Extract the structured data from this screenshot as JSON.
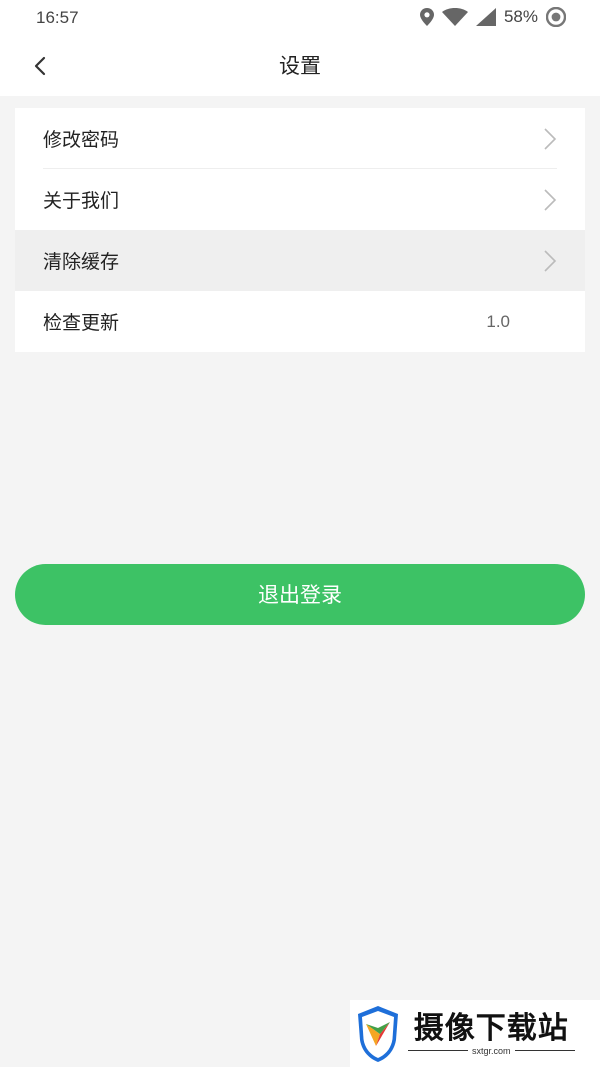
{
  "status_bar": {
    "time": "16:57",
    "battery": "58%",
    "icons": [
      "location-icon",
      "wifi-icon",
      "signal-icon",
      "eye-icon"
    ]
  },
  "header": {
    "back_icon": "chevron-left-icon",
    "title": "设置"
  },
  "settings": {
    "items": [
      {
        "label": "修改密码",
        "icon": "chevron-right-icon"
      },
      {
        "label": "关于我们",
        "icon": "chevron-right-icon"
      },
      {
        "label": "清除缓存",
        "icon": "chevron-right-icon"
      },
      {
        "label": "检查更新",
        "value": "1.0"
      }
    ]
  },
  "logout": {
    "label": "退出登录",
    "color": "#3dc265"
  },
  "watermark": {
    "title": "摄像下载站",
    "subtitle": "sxtgr.com"
  }
}
